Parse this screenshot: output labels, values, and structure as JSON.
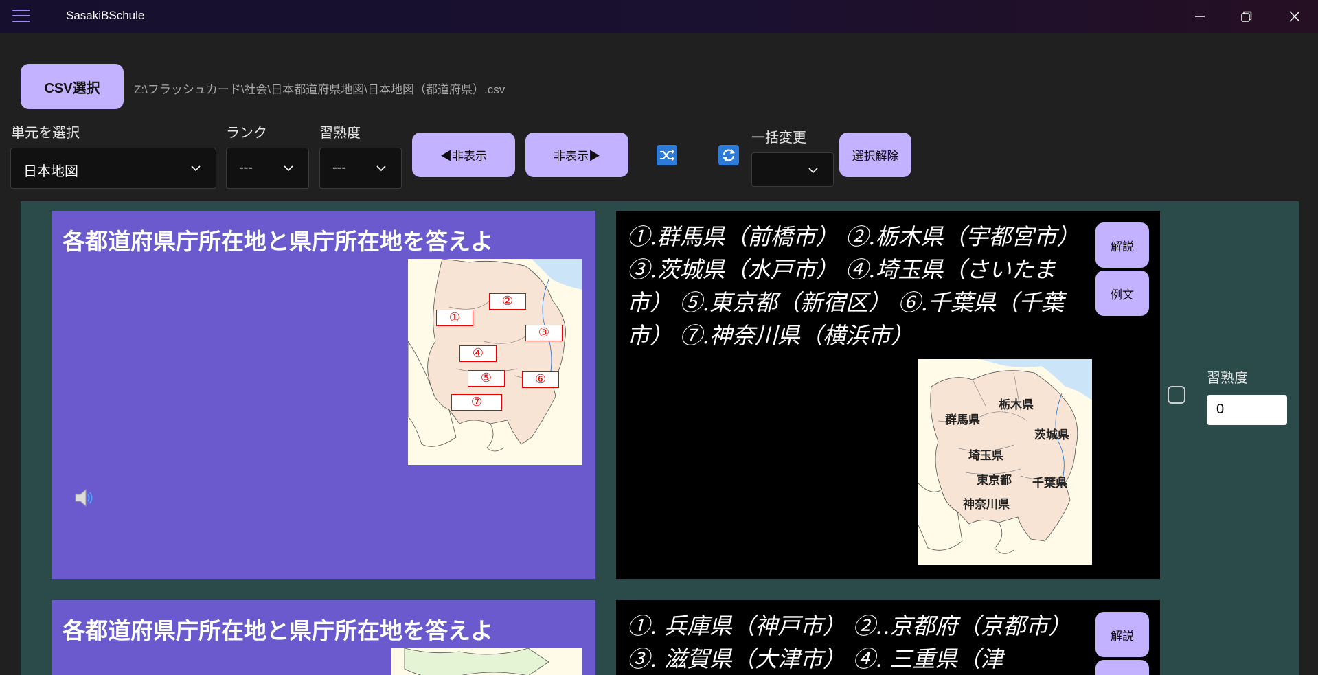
{
  "app": {
    "title": "SasakiBSchule"
  },
  "toolbar": {
    "csv_button": "CSV選択",
    "file_path": "Z:\\フラッシュカード\\社会\\日本都道府県地図\\日本地図（都道府県）.csv",
    "unit_label": "単元を選択",
    "unit_value": "日本地図",
    "rank_label": "ランク",
    "rank_value": "---",
    "mastery_label": "習熟度",
    "mastery_value": "---",
    "hide_left_button": "◀非表示",
    "hide_right_button": "非表示▶",
    "shuffle_icon": "shuffle-icon",
    "repeat_icon": "repeat-icon",
    "bulk_change_label": "一括変更",
    "bulk_change_value": "",
    "deselect_button": "選択解除"
  },
  "cards": [
    {
      "question": "各都道府県庁所在地と県庁所在地を答えよ",
      "answer": "①.群馬県（前橋市） ②.栃木県（宇都宮市） ③.茨城県（水戸市） ④.埼玉県（さいたま市） ⑤.東京都（新宿区） ⑥.千葉県（千葉市） ⑦.神奈川県（横浜市）",
      "explain_button": "解説",
      "example_button": "例文",
      "mastery_label": "習熟度",
      "mastery_value": "0",
      "q_map_markers": [
        "①",
        "②",
        "③",
        "④",
        "⑤",
        "⑥",
        "⑦"
      ],
      "a_map_labels": [
        "栃木県",
        "群馬県",
        "茨城県",
        "埼玉県",
        "東京都",
        "千葉県",
        "神奈川県"
      ]
    },
    {
      "question": "各都道府県庁所在地と県庁所在地を答えよ",
      "answer": "①. 兵庫県（神戸市） ②..京都府（京都市） ③. 滋賀県（大津市） ④. 三重県（津",
      "explain_button": "解説"
    }
  ],
  "colors": {
    "accent_button": "#c3b2ff",
    "question_bg": "#6a5acd",
    "answer_bg": "#000000",
    "panel_bg": "#2b4a4a",
    "map_land": "#f8e4d4",
    "map_sea": "#cce4f7"
  }
}
